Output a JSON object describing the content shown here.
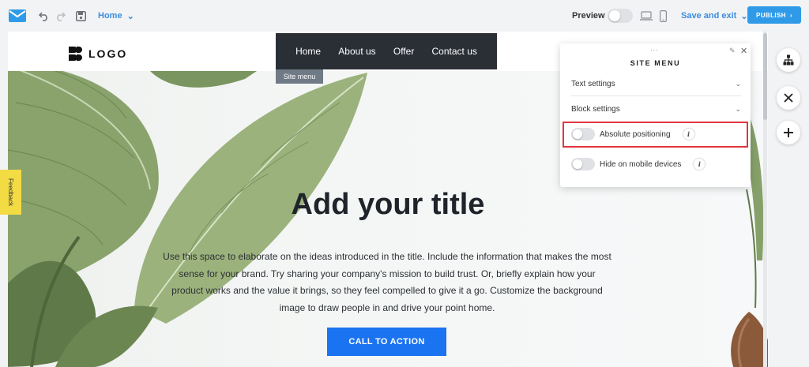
{
  "toolbar": {
    "page_select": "Home",
    "preview_label": "Preview",
    "save_exit_label": "Save and exit",
    "publish_label": "PUBLISH"
  },
  "site": {
    "logo_text": "LOGO",
    "nav": [
      "Home",
      "About us",
      "Offer",
      "Contact us"
    ],
    "site_menu_tag": "Site menu",
    "hero_title": "Add your title",
    "hero_body": "Use this space to elaborate on the ideas introduced in the title. Include the information that makes the most sense for your brand. Try sharing your company's mission to build trust. Or, briefly explain how your product works and the value it brings, so they feel compelled to give it a go. Customize the background image to draw people in and drive your point home.",
    "cta_label": "CALL TO ACTION"
  },
  "feedback_label": "Feedback",
  "panel": {
    "title": "SITE MENU",
    "text_settings": "Text settings",
    "block_settings": "Block settings",
    "absolute_positioning": "Absolute positioning",
    "hide_mobile": "Hide on mobile devices"
  },
  "colors": {
    "accent": "#2f9be8",
    "cta": "#1a73f0",
    "nav_bg": "#2a2f36",
    "highlight": "#e0353f",
    "feedback": "#f2db43"
  }
}
